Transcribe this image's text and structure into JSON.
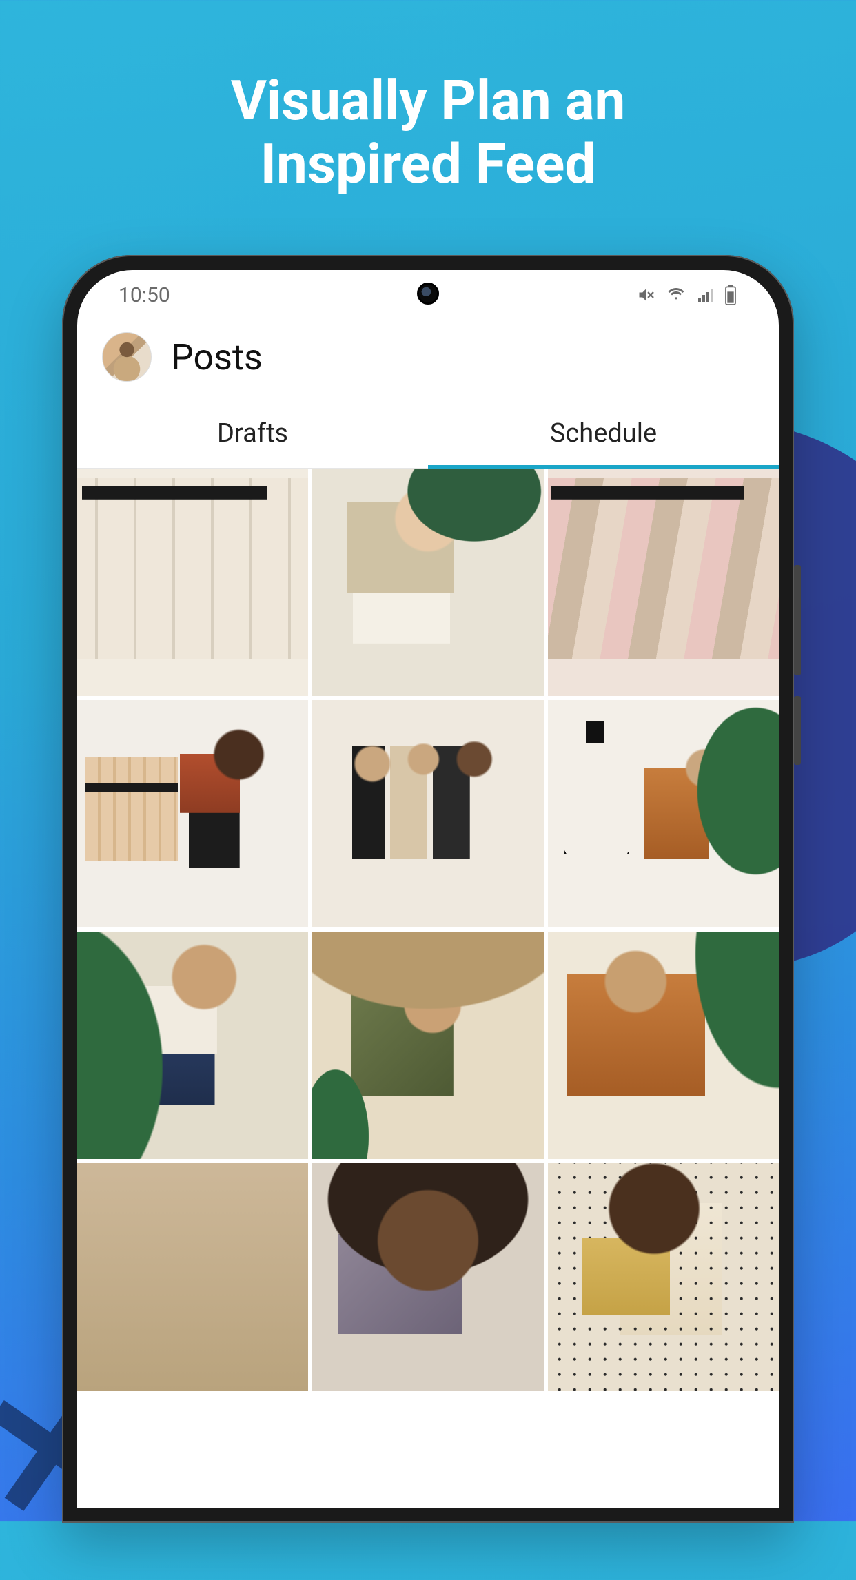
{
  "promo": {
    "title_line1": "Visually Plan an",
    "title_line2": "Inspired Feed"
  },
  "status": {
    "time": "10:50"
  },
  "header": {
    "title": "Posts"
  },
  "tabs": {
    "drafts": "Drafts",
    "schedule": "Schedule",
    "active": "schedule"
  },
  "grid": {
    "rows": 4,
    "cols": 3,
    "items": [
      "post-thumb-1",
      "post-thumb-2",
      "post-thumb-3",
      "post-thumb-4",
      "post-thumb-5",
      "post-thumb-6",
      "post-thumb-7",
      "post-thumb-8",
      "post-thumb-9",
      "post-thumb-10",
      "post-thumb-11",
      "post-thumb-12"
    ]
  }
}
